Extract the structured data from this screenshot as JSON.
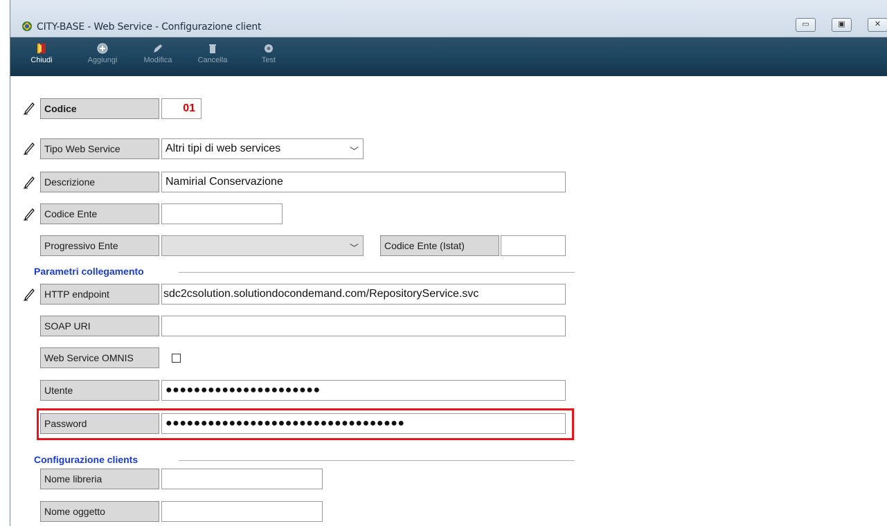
{
  "window": {
    "title": "CITY-BASE -  Web Service - Configurazione client",
    "buttons": [
      "minimize-button",
      "maximize-button",
      "close-button"
    ]
  },
  "toolbar": {
    "items": [
      {
        "label": "Chiudi",
        "icon": "exit-door-icon",
        "enabled": true
      },
      {
        "label": "Aggiungi",
        "icon": "add-icon",
        "enabled": false
      },
      {
        "label": "Modifica",
        "icon": "edit-icon",
        "enabled": false
      },
      {
        "label": "Cancella",
        "icon": "trash-icon",
        "enabled": false
      },
      {
        "label": "Test",
        "icon": "test-gear-icon",
        "enabled": false
      }
    ]
  },
  "form": {
    "codice": {
      "label": "Codice",
      "value": "01"
    },
    "tipo_web_service": {
      "label": "Tipo Web Service",
      "value": "Altri tipi di web services"
    },
    "descrizione": {
      "label": "Descrizione",
      "value": "Namirial Conservazione"
    },
    "codice_ente": {
      "label": "Codice Ente",
      "value": ""
    },
    "progressivo_ente": {
      "label": "Progressivo Ente",
      "value": ""
    },
    "codice_ente_istat": {
      "label": "Codice Ente (Istat)",
      "value": ""
    },
    "section_collegamento": "Parametri collegamento",
    "http_endpoint": {
      "label": "HTTP endpoint",
      "value": "sdc2csolution.solutiondocondemand.com/RepositoryService.svc"
    },
    "soap_uri": {
      "label": "SOAP URI",
      "value": ""
    },
    "web_service_omnis": {
      "label": "Web Service OMNIS",
      "checked": false
    },
    "utente": {
      "label": "Utente",
      "value": "●●●●●●●●●●●●●●●●●●●●●●"
    },
    "password": {
      "label": "Password",
      "value": "●●●●●●●●●●●●●●●●●●●●●●●●●●●●●●●●●●"
    },
    "section_clients": "Configurazione clients",
    "nome_libreria": {
      "label": "Nome libreria",
      "value": ""
    },
    "nome_oggetto": {
      "label": "Nome oggetto",
      "value": ""
    }
  },
  "colors": {
    "toolbar": "#1f4762",
    "section_title": "#1a3cd0",
    "highlight": "#e8141c",
    "codice_value": "#e00000"
  }
}
